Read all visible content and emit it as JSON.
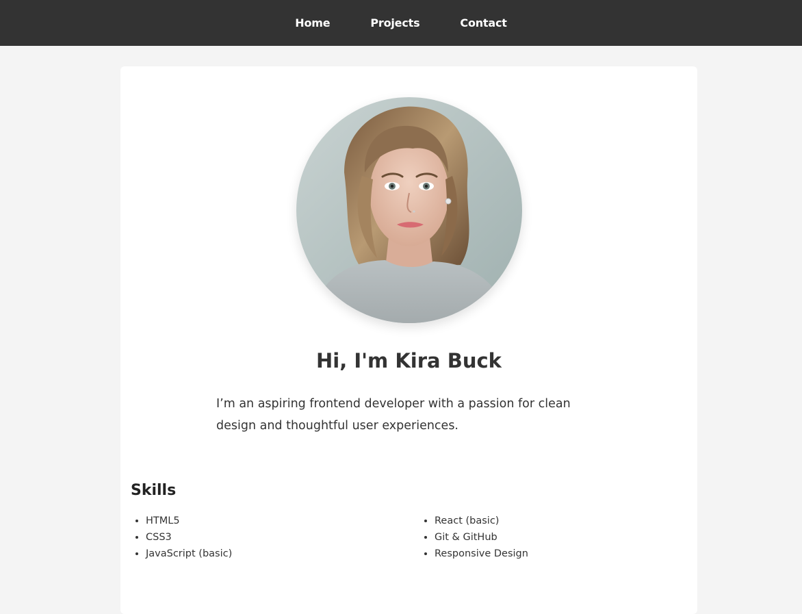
{
  "nav": {
    "items": [
      {
        "label": "Home"
      },
      {
        "label": "Projects"
      },
      {
        "label": "Contact"
      }
    ]
  },
  "profile": {
    "photo": "avatar-photo",
    "greeting": "Hi, I'm Kira Buck",
    "intro": "I’m an aspiring frontend developer with a passion for clean design and thoughtful user experiences."
  },
  "skills": {
    "title": "Skills",
    "left": [
      "HTML5",
      "CSS3",
      "JavaScript (basic)"
    ],
    "right": [
      "React (basic)",
      "Git & GitHub",
      "Responsive Design"
    ]
  },
  "colors": {
    "nav_bg": "#333333",
    "page_bg": "#f4f4f4",
    "card_bg": "#ffffff",
    "text": "#333333"
  }
}
